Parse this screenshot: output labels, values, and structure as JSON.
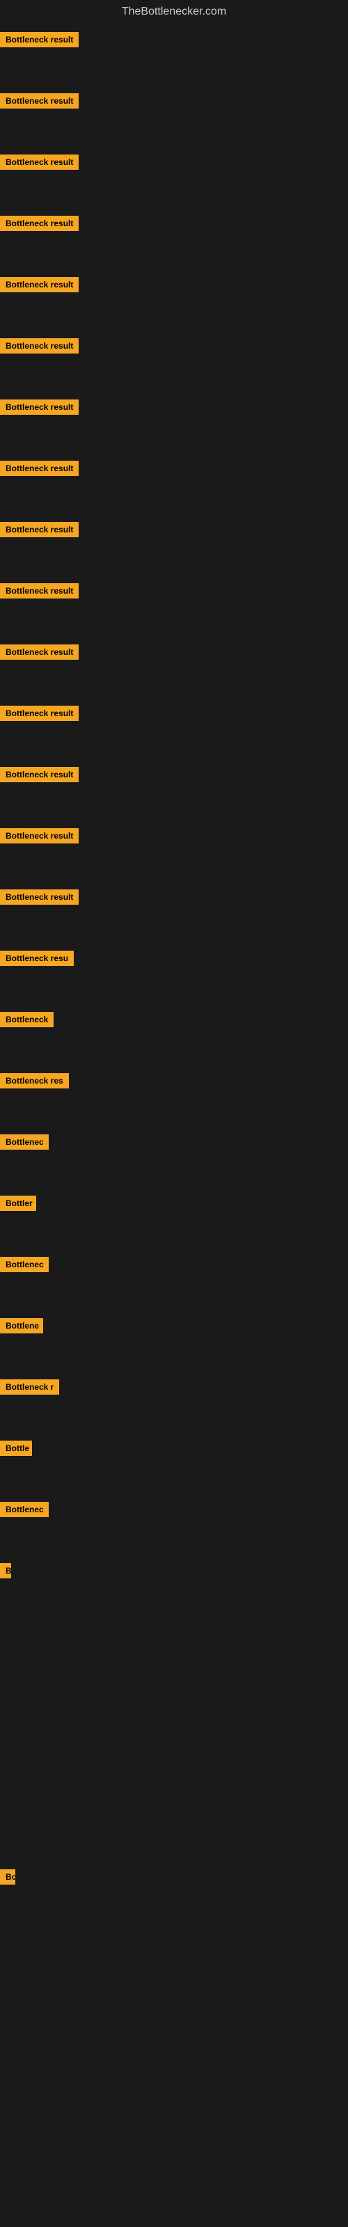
{
  "header": {
    "title": "TheBottlenecker.com"
  },
  "items": [
    {
      "label": "Bottleneck result",
      "badge_width": 130,
      "visible": true
    },
    {
      "label": "Bottleneck result",
      "badge_width": 130,
      "visible": true
    },
    {
      "label": "Bottleneck result",
      "badge_width": 130,
      "visible": true
    },
    {
      "label": "Bottleneck result",
      "badge_width": 130,
      "visible": true
    },
    {
      "label": "Bottleneck result",
      "badge_width": 130,
      "visible": true
    },
    {
      "label": "Bottleneck result",
      "badge_width": 130,
      "visible": true
    },
    {
      "label": "Bottleneck result",
      "badge_width": 130,
      "visible": true
    },
    {
      "label": "Bottleneck result",
      "badge_width": 130,
      "visible": true
    },
    {
      "label": "Bottleneck result",
      "badge_width": 130,
      "visible": true
    },
    {
      "label": "Bottleneck result",
      "badge_width": 130,
      "visible": true
    },
    {
      "label": "Bottleneck result",
      "badge_width": 130,
      "visible": true
    },
    {
      "label": "Bottleneck result",
      "badge_width": 130,
      "visible": true
    },
    {
      "label": "Bottleneck result",
      "badge_width": 130,
      "visible": true
    },
    {
      "label": "Bottleneck result",
      "badge_width": 130,
      "visible": true
    },
    {
      "label": "Bottleneck result",
      "badge_width": 130,
      "visible": true
    },
    {
      "label": "Bottleneck resu",
      "badge_width": 115,
      "visible": true
    },
    {
      "label": "Bottleneck",
      "badge_width": 78,
      "visible": true
    },
    {
      "label": "Bottleneck res",
      "badge_width": 105,
      "visible": true
    },
    {
      "label": "Bottlenec",
      "badge_width": 70,
      "visible": true
    },
    {
      "label": "Bottler",
      "badge_width": 52,
      "visible": true
    },
    {
      "label": "Bottlenec",
      "badge_width": 70,
      "visible": true
    },
    {
      "label": "Bottlene",
      "badge_width": 62,
      "visible": true
    },
    {
      "label": "Bottleneck r",
      "badge_width": 88,
      "visible": true
    },
    {
      "label": "Bottle",
      "badge_width": 46,
      "visible": true
    },
    {
      "label": "Bottlenec",
      "badge_width": 70,
      "visible": true
    },
    {
      "label": "B",
      "badge_width": 16,
      "visible": true
    },
    {
      "label": "",
      "badge_width": 4,
      "visible": false
    },
    {
      "label": "",
      "badge_width": 0,
      "visible": false
    },
    {
      "label": "",
      "badge_width": 0,
      "visible": false
    },
    {
      "label": "",
      "badge_width": 0,
      "visible": false
    },
    {
      "label": "Bo",
      "badge_width": 22,
      "visible": true
    },
    {
      "label": "",
      "badge_width": 0,
      "visible": false
    },
    {
      "label": "",
      "badge_width": 0,
      "visible": false
    },
    {
      "label": "",
      "badge_width": 0,
      "visible": false
    },
    {
      "label": "",
      "badge_width": 0,
      "visible": false
    }
  ],
  "colors": {
    "background": "#1a1a1a",
    "badge_bg": "#f5a623",
    "badge_text": "#000000",
    "title_text": "#cccccc"
  }
}
